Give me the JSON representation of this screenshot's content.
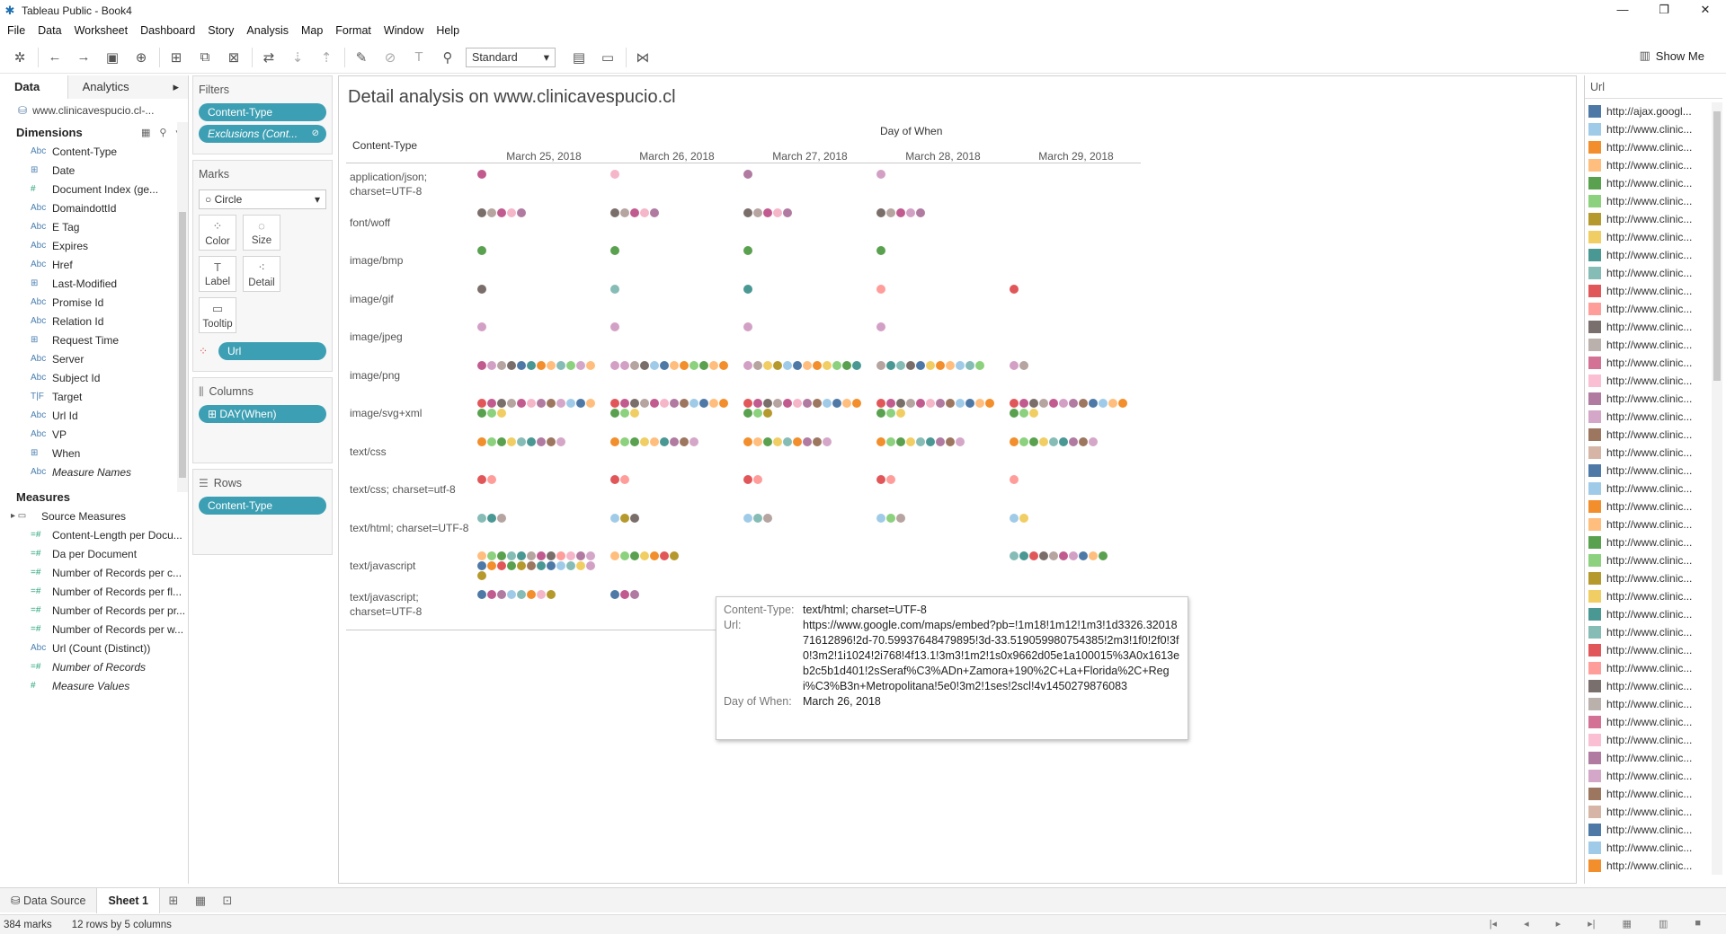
{
  "window": {
    "title": "Tableau Public - Book4",
    "controls": [
      "—",
      "❐",
      "✕"
    ]
  },
  "menu": [
    "File",
    "Data",
    "Worksheet",
    "Dashboard",
    "Story",
    "Analysis",
    "Map",
    "Format",
    "Window",
    "Help"
  ],
  "toolbar": {
    "fit": "Standard",
    "show_me": "Show Me"
  },
  "data_pane": {
    "tabs": [
      "Data",
      "Analytics"
    ],
    "datasource": "www.clinicavespucio.cl-...",
    "dimensions_title": "Dimensions",
    "dimensions": [
      {
        "type": "Abc",
        "name": "Content-Type",
        "italic": false
      },
      {
        "type": "⊞",
        "name": "Date",
        "italic": false
      },
      {
        "type": "#",
        "name": "Document Index (ge...",
        "italic": false
      },
      {
        "type": "Abc",
        "name": "DomaindottId",
        "italic": false
      },
      {
        "type": "Abc",
        "name": "E Tag",
        "italic": false
      },
      {
        "type": "Abc",
        "name": "Expires",
        "italic": false
      },
      {
        "type": "Abc",
        "name": "Href",
        "italic": false
      },
      {
        "type": "⊞",
        "name": "Last-Modified",
        "italic": false
      },
      {
        "type": "Abc",
        "name": "Promise Id",
        "italic": false
      },
      {
        "type": "Abc",
        "name": "Relation Id",
        "italic": false
      },
      {
        "type": "⊞",
        "name": "Request Time",
        "italic": false
      },
      {
        "type": "Abc",
        "name": "Server",
        "italic": false
      },
      {
        "type": "Abc",
        "name": "Subject Id",
        "italic": false
      },
      {
        "type": "T|F",
        "name": "Target",
        "italic": false
      },
      {
        "type": "Abc",
        "name": "Url Id",
        "italic": false
      },
      {
        "type": "Abc",
        "name": "VP",
        "italic": false
      },
      {
        "type": "⊞",
        "name": "When",
        "italic": false
      },
      {
        "type": "Abc",
        "name": "Measure Names",
        "italic": true
      }
    ],
    "measures_title": "Measures",
    "measures": [
      {
        "type": "▸ ▭",
        "name": "Source Measures",
        "italic": false,
        "folder": true
      },
      {
        "type": "=#",
        "name": "Content-Length per Docu...",
        "italic": false
      },
      {
        "type": "=#",
        "name": "Da per Document",
        "italic": false
      },
      {
        "type": "=#",
        "name": "Number of Records per c...",
        "italic": false
      },
      {
        "type": "=#",
        "name": "Number of Records per fl...",
        "italic": false
      },
      {
        "type": "=#",
        "name": "Number of Records per pr...",
        "italic": false
      },
      {
        "type": "=#",
        "name": "Number of Records per w...",
        "italic": false
      },
      {
        "type": "Abc",
        "name": "Url (Count (Distinct))",
        "italic": false
      },
      {
        "type": "=#",
        "name": "Number of Records",
        "italic": true
      },
      {
        "type": "#",
        "name": "Measure Values",
        "italic": true
      }
    ]
  },
  "shelves": {
    "filters_title": "Filters",
    "filters": [
      {
        "label": "Content-Type",
        "italic": false,
        "icon": ""
      },
      {
        "label": "Exclusions (Cont...",
        "italic": true,
        "icon": "⊘"
      }
    ],
    "marks_title": "Marks",
    "mark_type": "Circle",
    "mark_buttons": [
      {
        "icon": "⁘",
        "label": "Color"
      },
      {
        "icon": "◌",
        "label": "Size"
      },
      {
        "icon": "T",
        "label": "Label"
      },
      {
        "icon": "⁖",
        "label": "Detail"
      },
      {
        "icon": "▭",
        "label": "Tooltip"
      }
    ],
    "mark_pill": "Url",
    "columns_title": "Columns",
    "columns_pill": "⊞ DAY(When)",
    "rows_title": "Rows",
    "rows_pill": "Content-Type"
  },
  "view": {
    "title": "Detail analysis on www.clinicavespucio.cl",
    "column_title": "Day of When",
    "row_field_header": "Content-Type",
    "columns": [
      "March 25, 2018",
      "March 26, 2018",
      "March 27, 2018",
      "March 28, 2018",
      "March 29, 2018"
    ],
    "rows": [
      {
        "label": "application/json;\ncharset=UTF-8",
        "dots": [
          [
            "#c15b8f"
          ],
          [
            "#f4b6c8"
          ],
          [
            "#b07aa1"
          ],
          [
            "#d3a0c5"
          ],
          []
        ]
      },
      {
        "label": "font/woff",
        "dots": [
          [
            "#7a6e6a",
            "#b6a4a0",
            "#c15b8f",
            "#f4b6c8",
            "#b07aa1"
          ],
          [
            "#7a6e6a",
            "#b6a4a0",
            "#c15b8f",
            "#f4b6c8",
            "#b07aa1"
          ],
          [
            "#7a6e6a",
            "#b6a4a0",
            "#c15b8f",
            "#f4b6c8",
            "#b07aa1"
          ],
          [
            "#7a6e6a",
            "#b6a4a0",
            "#c15b8f",
            "#d3a0c5",
            "#b07aa1"
          ],
          []
        ]
      },
      {
        "label": "image/bmp",
        "dots": [
          [
            "#59a14f"
          ],
          [
            "#59a14f"
          ],
          [
            "#59a14f"
          ],
          [
            "#59a14f"
          ],
          []
        ]
      },
      {
        "label": "image/gif",
        "dots": [
          [
            "#7a6e6a"
          ],
          [
            "#86bcb6"
          ],
          [
            "#499894"
          ],
          [
            "#ff9d9a"
          ],
          [
            "#e15759"
          ]
        ]
      },
      {
        "label": "image/jpeg",
        "dots": [
          [
            "#d3a0c5"
          ],
          [
            "#d3a0c5"
          ],
          [
            "#d3a0c5"
          ],
          [
            "#d3a0c5"
          ],
          []
        ]
      },
      {
        "label": "image/png",
        "dots": [
          [
            "#c15b8f",
            "#d3a0c5",
            "#b6a4a0",
            "#7a6e6a",
            "#4e79a7",
            "#499894",
            "#f28e2b",
            "#ffbe7d",
            "#86bcb6",
            "#8cd17d",
            "#d4a6c8",
            "#ffbe7d"
          ],
          [
            "#d3a0c5",
            "#d3a0c5",
            "#b6a4a0",
            "#7a6e6a",
            "#a0cbe8",
            "#4e79a7",
            "#ffbe7d",
            "#f28e2b",
            "#8cd17d",
            "#59a14f",
            "#ffbe7d",
            "#f28e2b"
          ],
          [
            "#d3a0c5",
            "#b6a4a0",
            "#f1ce63",
            "#b6992d",
            "#a0cbe8",
            "#4e79a7",
            "#ffbe7d",
            "#f28e2b",
            "#f1ce63",
            "#8cd17d",
            "#59a14f",
            "#499894"
          ],
          [
            "#b6a4a0",
            "#499894",
            "#86bcb6",
            "#7a6e6a",
            "#4e79a7",
            "#f1ce63",
            "#f28e2b",
            "#ffbe7d",
            "#a0cbe8",
            "#86bcb6",
            "#8cd17d"
          ],
          [
            "#d3a0c5",
            "#b6a4a0"
          ]
        ]
      },
      {
        "label": "image/svg+xml",
        "dots": [
          [
            "#e15759",
            "#c15b8f",
            "#7a6e6a",
            "#b6a4a0",
            "#c15b8f",
            "#f4b6c8",
            "#b07aa1",
            "#9d7660",
            "#d4a6c8",
            "#a0cbe8",
            "#4e79a7",
            "#ffbe7d",
            "#59a14f",
            "#8cd17d",
            "#f1ce63"
          ],
          [
            "#e15759",
            "#c15b8f",
            "#7a6e6a",
            "#b6a4a0",
            "#c15b8f",
            "#f4b6c8",
            "#b07aa1",
            "#9d7660",
            "#a0cbe8",
            "#4e79a7",
            "#ffbe7d",
            "#f28e2b",
            "#59a14f",
            "#8cd17d",
            "#f1ce63"
          ],
          [
            "#e15759",
            "#c15b8f",
            "#7a6e6a",
            "#b6a4a0",
            "#c15b8f",
            "#f4b6c8",
            "#b07aa1",
            "#9d7660",
            "#a0cbe8",
            "#4e79a7",
            "#ffbe7d",
            "#f28e2b",
            "#59a14f",
            "#8cd17d",
            "#b6992d"
          ],
          [
            "#e15759",
            "#c15b8f",
            "#7a6e6a",
            "#b6a4a0",
            "#c15b8f",
            "#f4b6c8",
            "#b07aa1",
            "#9d7660",
            "#a0cbe8",
            "#4e79a7",
            "#ffbe7d",
            "#f28e2b",
            "#59a14f",
            "#8cd17d",
            "#f1ce63"
          ],
          [
            "#e15759",
            "#c15b8f",
            "#7a6e6a",
            "#b6a4a0",
            "#c15b8f",
            "#d3a0c5",
            "#b07aa1",
            "#9d7660",
            "#4e79a7",
            "#a0cbe8",
            "#ffbe7d",
            "#f28e2b",
            "#59a14f",
            "#8cd17d",
            "#f1ce63"
          ]
        ]
      },
      {
        "label": "text/css",
        "dots": [
          [
            "#f28e2b",
            "#8cd17d",
            "#59a14f",
            "#f1ce63",
            "#86bcb6",
            "#499894",
            "#b07aa1",
            "#9d7660",
            "#d4a6c8"
          ],
          [
            "#f28e2b",
            "#8cd17d",
            "#59a14f",
            "#f1ce63",
            "#ffbe7d",
            "#499894",
            "#b07aa1",
            "#9d7660",
            "#d4a6c8"
          ],
          [
            "#f28e2b",
            "#ffbe7d",
            "#59a14f",
            "#f1ce63",
            "#86bcb6",
            "#f28e2b",
            "#b07aa1",
            "#9d7660",
            "#d4a6c8"
          ],
          [
            "#f28e2b",
            "#8cd17d",
            "#59a14f",
            "#f1ce63",
            "#86bcb6",
            "#499894",
            "#b07aa1",
            "#9d7660",
            "#d4a6c8"
          ],
          [
            "#f28e2b",
            "#8cd17d",
            "#59a14f",
            "#f1ce63",
            "#86bcb6",
            "#499894",
            "#b07aa1",
            "#9d7660",
            "#d4a6c8"
          ]
        ]
      },
      {
        "label": "text/css; charset=utf-8",
        "dots": [
          [
            "#e15759",
            "#ff9d9a"
          ],
          [
            "#e15759",
            "#ff9d9a"
          ],
          [
            "#e15759",
            "#ff9d9a"
          ],
          [
            "#e15759",
            "#ff9d9a"
          ],
          [
            "#ff9d9a"
          ]
        ]
      },
      {
        "label": "text/html; charset=UTF-8",
        "dots": [
          [
            "#86bcb6",
            "#499894",
            "#b6a4a0"
          ],
          [
            "#a0cbe8",
            "#b6992d",
            "#7a6e6a"
          ],
          [
            "#a0cbe8",
            "#86bcb6",
            "#b6a4a0"
          ],
          [
            "#a0cbe8",
            "#8cd17d",
            "#b6a4a0"
          ],
          [
            "#a0cbe8",
            "#f1ce63"
          ]
        ]
      },
      {
        "label": "text/javascript",
        "dots": [
          [
            "#ffbe7d",
            "#8cd17d",
            "#59a14f",
            "#86bcb6",
            "#499894",
            "#b6a4a0",
            "#c15b8f",
            "#7a6e6a",
            "#ff9d9a",
            "#f4b6c8",
            "#b07aa1",
            "#d4a6c8",
            "#4e79a7",
            "#f28e2b",
            "#e15759",
            "#59a14f",
            "#b6992d",
            "#9d7660",
            "#499894",
            "#4e79a7",
            "#a0cbe8",
            "#86bcb6",
            "#f1ce63",
            "#d3a0c5",
            "#b6992d"
          ],
          [
            "#ffbe7d",
            "#8cd17d",
            "#59a14f",
            "#f1ce63",
            "#f28e2b",
            "#e15759",
            "#b6992d"
          ],
          [],
          [],
          [
            "#86bcb6",
            "#499894",
            "#e15759",
            "#7a6e6a",
            "#b6a4a0",
            "#c15b8f",
            "#d3a0c5",
            "#4e79a7",
            "#ffbe7d",
            "#59a14f"
          ]
        ]
      },
      {
        "label": "text/javascript;\ncharset=UTF-8",
        "dots": [
          [
            "#4e79a7",
            "#c15b8f",
            "#b07aa1",
            "#a0cbe8",
            "#86bcb6",
            "#f28e2b",
            "#f4b6c8",
            "#b6992d"
          ],
          [
            "#4e79a7",
            "#c15b8f",
            "#b07aa1"
          ],
          [],
          [],
          []
        ]
      }
    ]
  },
  "tooltip": {
    "rows": [
      {
        "key": "Content-Type:",
        "value": "text/html; charset=UTF-8"
      },
      {
        "key": "Url:",
        "value": "https://www.google.com/maps/embed?pb=!1m18!1m12!1m3!1d3326.3201871612896!2d-70.59937648479895!3d-33.519059980754385!2m3!1f0!2f0!3f0!3m2!1i1024!2i768!4f13.1!3m3!1m2!1s0x9662d05e1a100015%3A0x1613eb2c5b1d401!2sSeraf%C3%ADn+Zamora+190%2C+La+Florida%2C+Regi%C3%B3n+Metropolitana!5e0!3m2!1ses!2scl!4v1450279876083"
      },
      {
        "key": "Day of When:",
        "value": "March 26, 2018"
      }
    ]
  },
  "legend": {
    "title": "Url",
    "items": [
      {
        "label": "http://ajax.googl...",
        "color": "#4e79a7"
      },
      {
        "label": "http://www.clinic...",
        "color": "#a0cbe8"
      },
      {
        "label": "http://www.clinic...",
        "color": "#f28e2b"
      },
      {
        "label": "http://www.clinic...",
        "color": "#ffbe7d"
      },
      {
        "label": "http://www.clinic...",
        "color": "#59a14f"
      },
      {
        "label": "http://www.clinic...",
        "color": "#8cd17d"
      },
      {
        "label": "http://www.clinic...",
        "color": "#b6992d"
      },
      {
        "label": "http://www.clinic...",
        "color": "#f1ce63"
      },
      {
        "label": "http://www.clinic...",
        "color": "#499894"
      },
      {
        "label": "http://www.clinic...",
        "color": "#86bcb6"
      },
      {
        "label": "http://www.clinic...",
        "color": "#e15759"
      },
      {
        "label": "http://www.clinic...",
        "color": "#ff9d9a"
      },
      {
        "label": "http://www.clinic...",
        "color": "#79706e"
      },
      {
        "label": "http://www.clinic...",
        "color": "#bab0ac"
      },
      {
        "label": "http://www.clinic...",
        "color": "#d37295"
      },
      {
        "label": "http://www.clinic...",
        "color": "#fabfd2"
      },
      {
        "label": "http://www.clinic...",
        "color": "#b07aa1"
      },
      {
        "label": "http://www.clinic...",
        "color": "#d4a6c8"
      },
      {
        "label": "http://www.clinic...",
        "color": "#9d7660"
      },
      {
        "label": "http://www.clinic...",
        "color": "#d7b5a6"
      },
      {
        "label": "http://www.clinic...",
        "color": "#4e79a7"
      },
      {
        "label": "http://www.clinic...",
        "color": "#a0cbe8"
      },
      {
        "label": "http://www.clinic...",
        "color": "#f28e2b"
      },
      {
        "label": "http://www.clinic...",
        "color": "#ffbe7d"
      },
      {
        "label": "http://www.clinic...",
        "color": "#59a14f"
      },
      {
        "label": "http://www.clinic...",
        "color": "#8cd17d"
      },
      {
        "label": "http://www.clinic...",
        "color": "#b6992d"
      },
      {
        "label": "http://www.clinic...",
        "color": "#f1ce63"
      },
      {
        "label": "http://www.clinic...",
        "color": "#499894"
      },
      {
        "label": "http://www.clinic...",
        "color": "#86bcb6"
      },
      {
        "label": "http://www.clinic...",
        "color": "#e15759"
      },
      {
        "label": "http://www.clinic...",
        "color": "#ff9d9a"
      },
      {
        "label": "http://www.clinic...",
        "color": "#79706e"
      },
      {
        "label": "http://www.clinic...",
        "color": "#bab0ac"
      },
      {
        "label": "http://www.clinic...",
        "color": "#d37295"
      },
      {
        "label": "http://www.clinic...",
        "color": "#fabfd2"
      },
      {
        "label": "http://www.clinic...",
        "color": "#b07aa1"
      },
      {
        "label": "http://www.clinic...",
        "color": "#d4a6c8"
      },
      {
        "label": "http://www.clinic...",
        "color": "#9d7660"
      },
      {
        "label": "http://www.clinic...",
        "color": "#d7b5a6"
      },
      {
        "label": "http://www.clinic...",
        "color": "#4e79a7"
      },
      {
        "label": "http://www.clinic...",
        "color": "#a0cbe8"
      },
      {
        "label": "http://www.clinic...",
        "color": "#f28e2b"
      }
    ]
  },
  "sheets": {
    "datasource_tab": "Data Source",
    "active_sheet": "Sheet 1"
  },
  "status": {
    "marks": "384 marks",
    "dims": "12 rows by 5 columns"
  }
}
